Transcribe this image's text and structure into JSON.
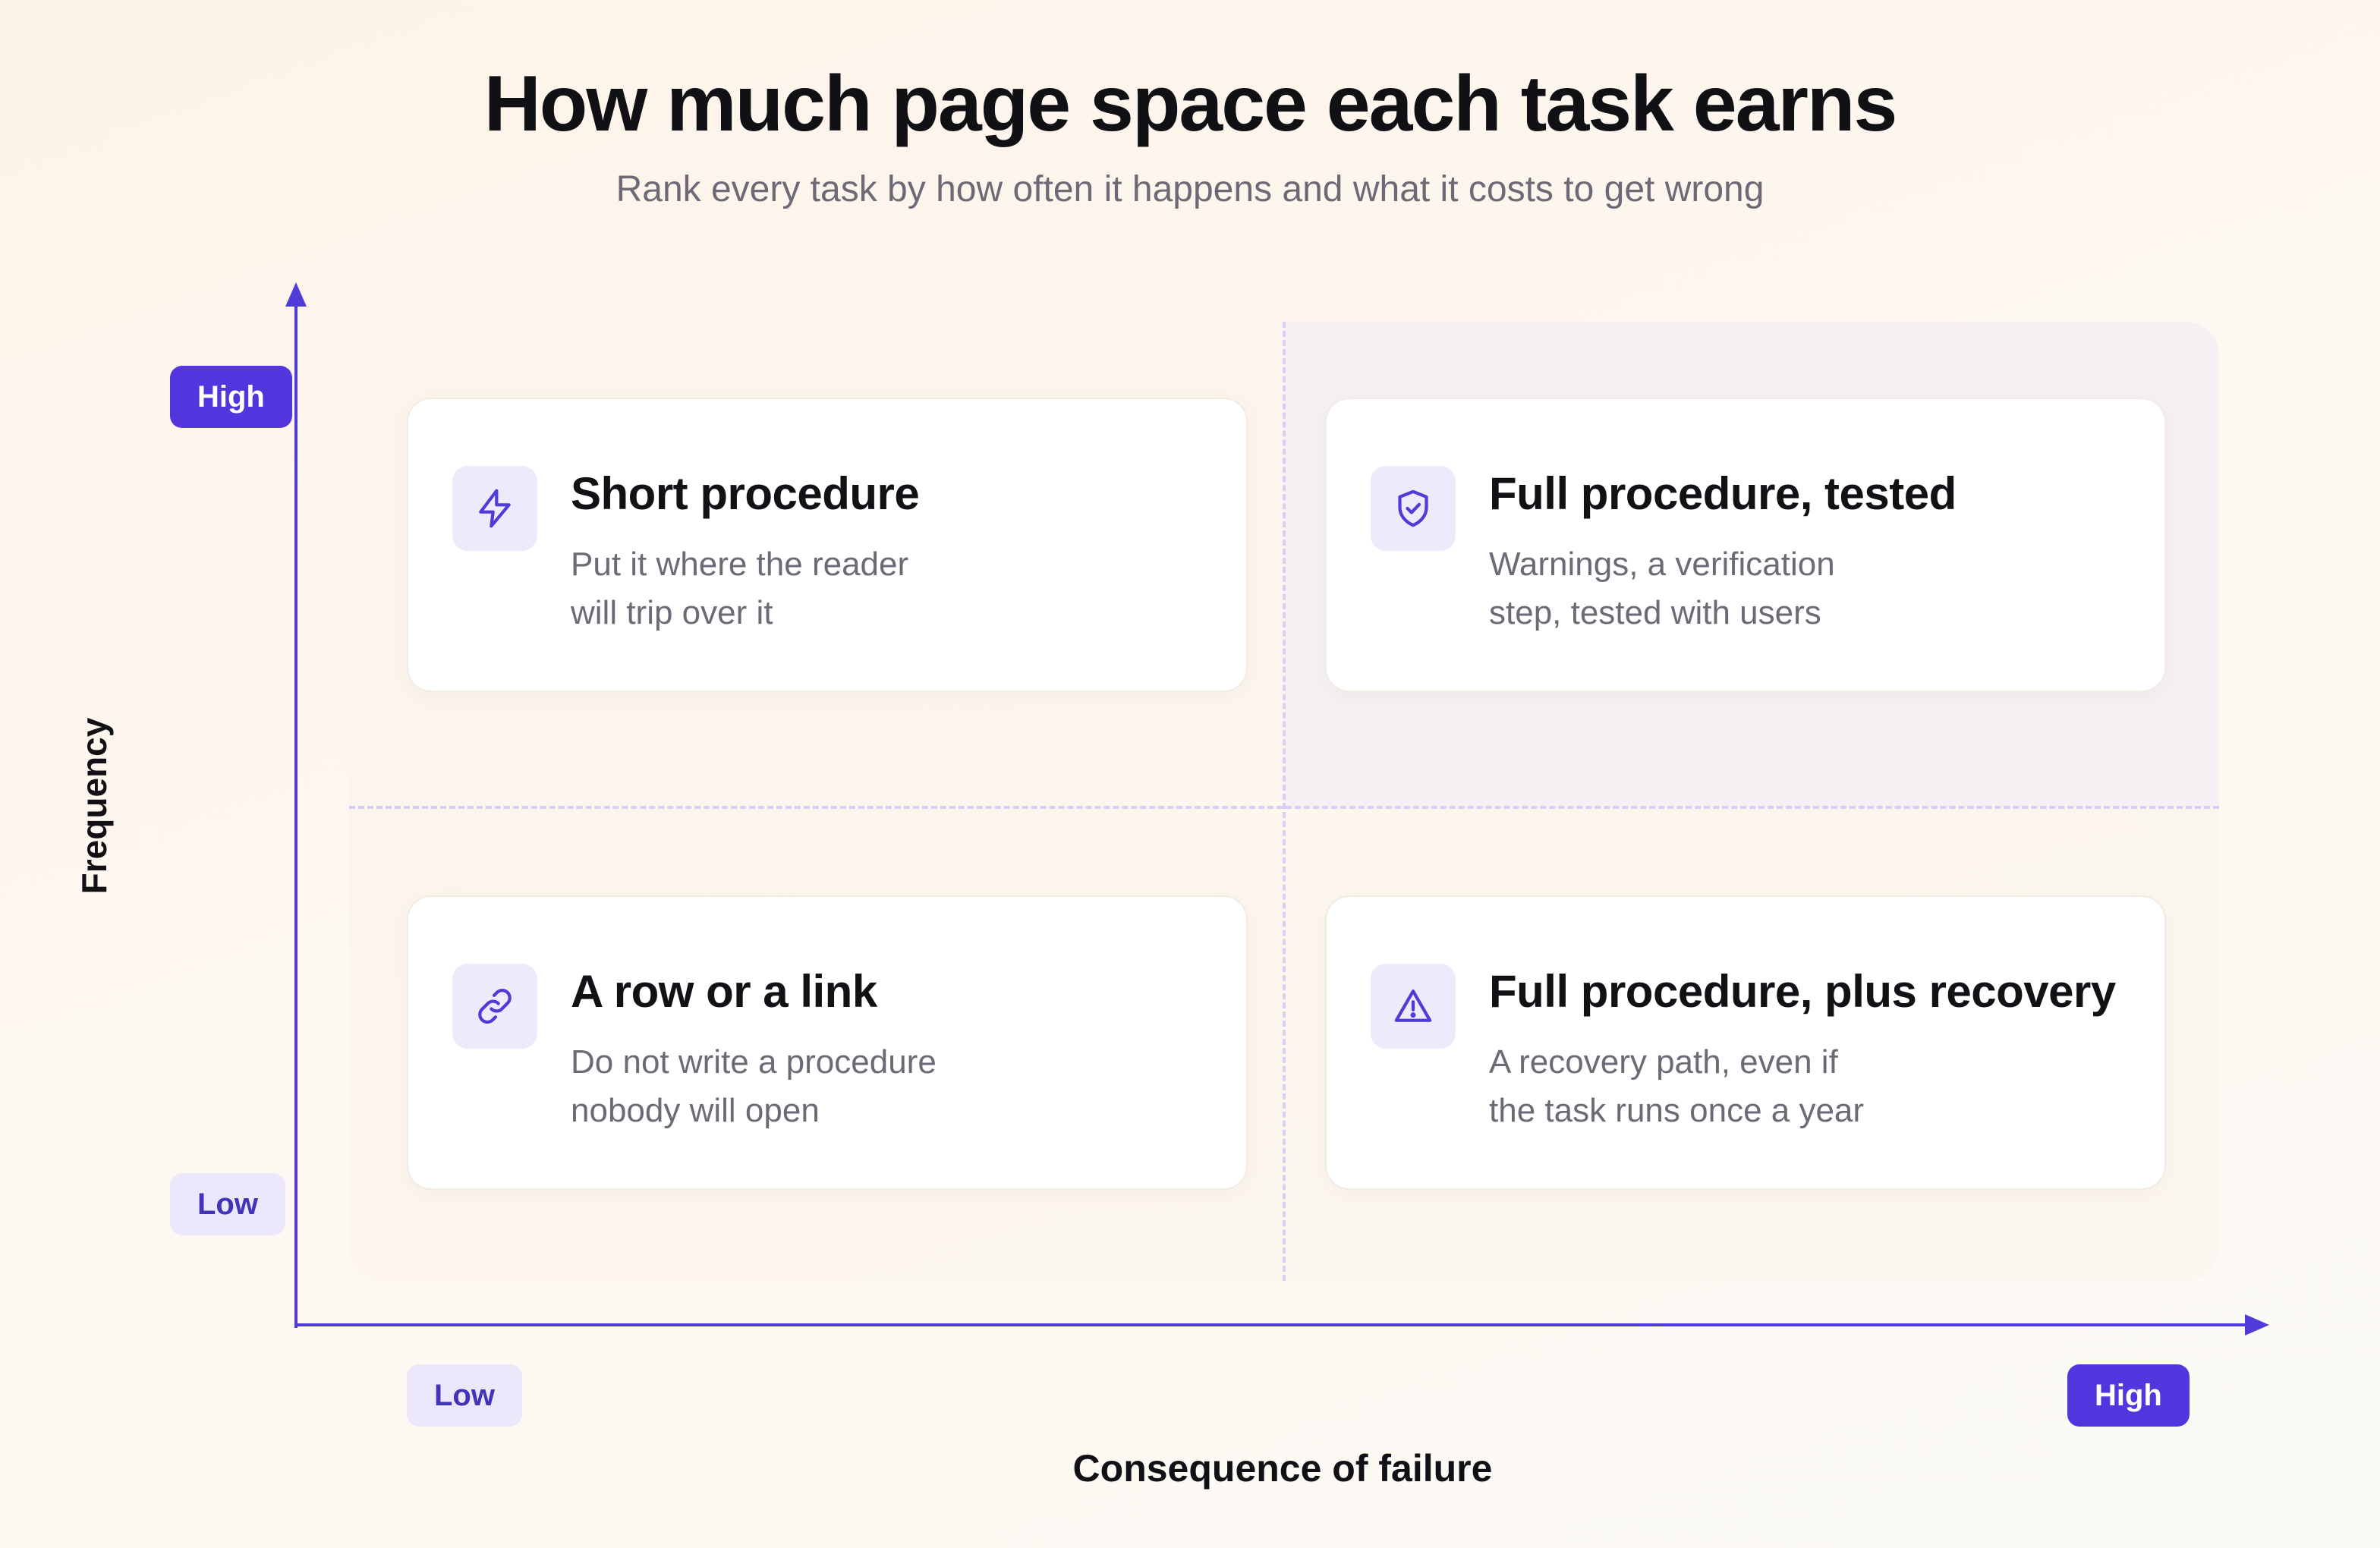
{
  "header": {
    "title": "How much page space each task earns",
    "subtitle": "Rank every task by how often it happens and what it costs to get wrong"
  },
  "axes": {
    "y": {
      "title": "Frequency",
      "high_label": "High",
      "low_label": "Low"
    },
    "x": {
      "title": "Consequence of failure",
      "low_label": "Low",
      "high_label": "High"
    }
  },
  "quadrants": [
    {
      "id": "high-frequency-low-consequence",
      "icon": "lightning-bolt-icon",
      "title": "Short procedure",
      "body": "Put it where the reader\nwill trip over it"
    },
    {
      "id": "high-frequency-high-consequence",
      "icon": "shield-check-icon",
      "title": "Full procedure, tested",
      "body": "Warnings, a verification\nstep, tested with users"
    },
    {
      "id": "low-frequency-low-consequence",
      "icon": "link-icon",
      "title": "A row or a link",
      "body": "Do not write a procedure\nnobody will open"
    },
    {
      "id": "low-frequency-high-consequence",
      "icon": "warning-triangle-icon",
      "title": "Full procedure, plus recovery",
      "body": "A recovery path, even if\nthe task runs once a year"
    }
  ],
  "colors": {
    "accent": "#5235dc",
    "accent_soft": "#ece8fb",
    "highlight_quadrant": "#f5f0f4",
    "card": "#ffffff",
    "muted_text": "#6d6a76"
  }
}
